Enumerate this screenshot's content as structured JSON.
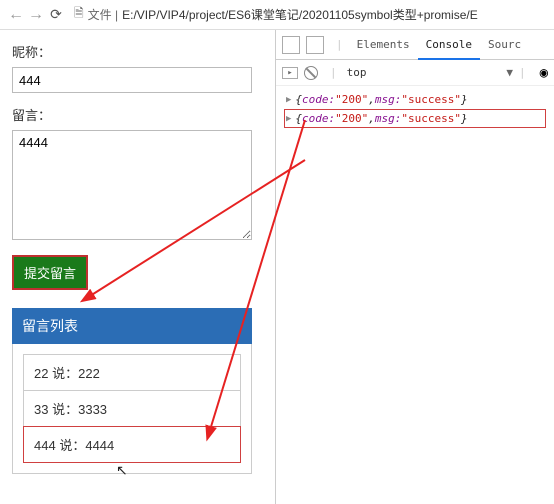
{
  "browser": {
    "prefix_label": "文件",
    "url": "E:/VIP/VIP4/project/ES6课堂笔记/20201105symbol类型+promise/E"
  },
  "form": {
    "nickname_label": "昵称：",
    "nickname_value": "444",
    "message_label": "留言：",
    "message_value": "4444",
    "submit_label": "提交留言"
  },
  "list": {
    "header": "留言列表",
    "rows": [
      {
        "who": "22",
        "says": "说：",
        "msg": "222"
      },
      {
        "who": "33",
        "says": "说：",
        "msg": "3333"
      },
      {
        "who": "444",
        "says": "说：",
        "msg": "4444"
      }
    ]
  },
  "devtools": {
    "tabs": {
      "elements": "Elements",
      "console": "Console",
      "sources": "Sourc"
    },
    "scope": "top",
    "logs": [
      {
        "code_key": "code:",
        "code_val": "\"200\"",
        "msg_key": "msg:",
        "msg_val": "\"success\""
      },
      {
        "code_key": "code:",
        "code_val": "\"200\"",
        "msg_key": "msg:",
        "msg_val": "\"success\""
      }
    ]
  }
}
